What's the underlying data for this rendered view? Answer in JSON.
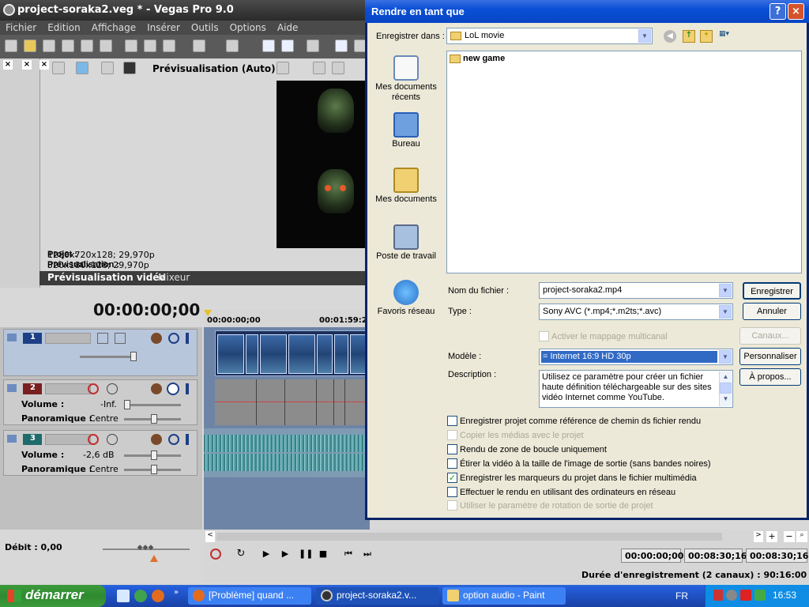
{
  "vegas": {
    "title": "project-soraka2.veg * - Vegas Pro 9.0",
    "menu": [
      "Fichier",
      "Edition",
      "Affichage",
      "Insérer",
      "Outils",
      "Options",
      "Aide"
    ],
    "preview_mode": "Prévisualisation (Auto)",
    "project_label": "Projet :",
    "project_value": "1280x720x128; 29,970p",
    "preview_label": "Prévisualisation :",
    "preview_value": "320x180x128; 29,970p",
    "tabs": [
      "Prévisualisation vidéo",
      "Mixeur"
    ],
    "timecode": "00:00:00;00",
    "ruler": [
      "00:00:00;00",
      "00:01:59:2"
    ],
    "tracks": [
      {
        "num": "1",
        "color": "#1d3f86"
      },
      {
        "num": "2",
        "color": "#7a1f1f",
        "volume_label": "Volume :",
        "volume_value": "-Inf.",
        "pan_label": "Panoramique :",
        "pan_value": "Centre"
      },
      {
        "num": "3",
        "color": "#1f6a6a",
        "volume_label": "Volume :",
        "volume_value": "-2,6 dB",
        "pan_label": "Panoramique :",
        "pan_value": "Centre"
      }
    ],
    "debit": "Débit : 0,00",
    "transport_times": [
      "00:00:00;00",
      "00:08:30;16",
      "00:08:30;16"
    ],
    "duration": "Durée d'enregistrement (2 canaux) : 90:16:00"
  },
  "dialog": {
    "title": "Rendre en tant que",
    "save_in_label": "Enregistrer dans :",
    "save_in_value": "LoL movie",
    "places": [
      "Mes documents récents",
      "Bureau",
      "Mes documents",
      "Poste de travail",
      "Favoris réseau"
    ],
    "files": [
      "new game"
    ],
    "filename_label": "Nom du fichier :",
    "filename_value": "project-soraka2.mp4",
    "type_label": "Type :",
    "type_value": "Sony AVC (*.mp4;*.m2ts;*.avc)",
    "save_button": "Enregistrer",
    "cancel_button": "Annuler",
    "multichannel_label": "Activer le mappage multicanal",
    "channels_button": "Canaux...",
    "template_label": "Modèle :",
    "template_value": "= Internet 16:9 HD 30p",
    "customize_button": "Personnaliser",
    "about_button": "À propos...",
    "description_label": "Description :",
    "description_value": "Utilisez ce paramètre pour créer un fichier haute définition téléchargeable sur des sites vidéo Internet comme YouTube.",
    "options": [
      {
        "label": "Enregistrer projet comme référence de chemin ds fichier rendu",
        "checked": false,
        "enabled": true
      },
      {
        "label": "Copier les médias avec le projet",
        "checked": false,
        "enabled": false
      },
      {
        "label": "Rendu de zone de boucle uniquement",
        "checked": false,
        "enabled": true
      },
      {
        "label": "Étirer la vidéo à la taille de l'image de sortie (sans bandes noires)",
        "checked": false,
        "enabled": true
      },
      {
        "label": "Enregistrer les marqueurs du projet dans le fichier multimédia",
        "checked": true,
        "enabled": true
      },
      {
        "label": "Effectuer le rendu en utilisant des ordinateurs en réseau",
        "checked": false,
        "enabled": true
      },
      {
        "label": "Utiliser le paramètre de rotation de sortie de projet",
        "checked": false,
        "enabled": false
      }
    ]
  },
  "taskbar": {
    "start": "démarrer",
    "tasks": [
      "[Problème] quand ...",
      "project-soraka2.v...",
      "option audio - Paint"
    ],
    "language": "FR",
    "clock": "16:53"
  }
}
